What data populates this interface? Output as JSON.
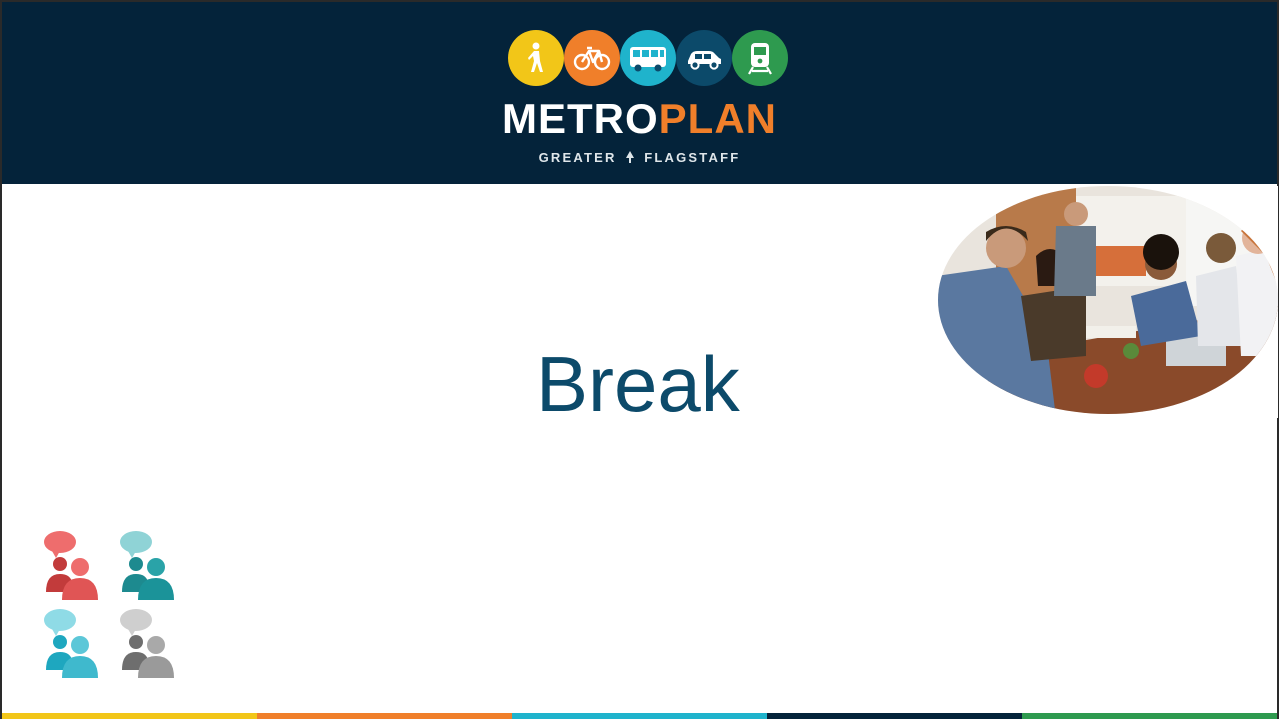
{
  "header": {
    "brand_part1": "METRO",
    "brand_part2": "PLAN",
    "tagline_left": "GREATER",
    "tagline_right": "FLAGSTAFF",
    "mode_icons": [
      {
        "name": "walk-icon",
        "color": "#f2c618"
      },
      {
        "name": "bike-icon",
        "color": "#f07f2a"
      },
      {
        "name": "bus-icon",
        "color": "#1fb3cc"
      },
      {
        "name": "car-icon",
        "color": "#0c4a6a"
      },
      {
        "name": "train-icon",
        "color": "#2e9a4f"
      }
    ]
  },
  "slide": {
    "title": "Break"
  },
  "colors": {
    "header_bg": "#04233a",
    "title": "#0c4a6a",
    "bottom_bar": [
      "#f2c618",
      "#f07f2a",
      "#1fb3cc",
      "#04233a",
      "#2e9a4f"
    ]
  }
}
